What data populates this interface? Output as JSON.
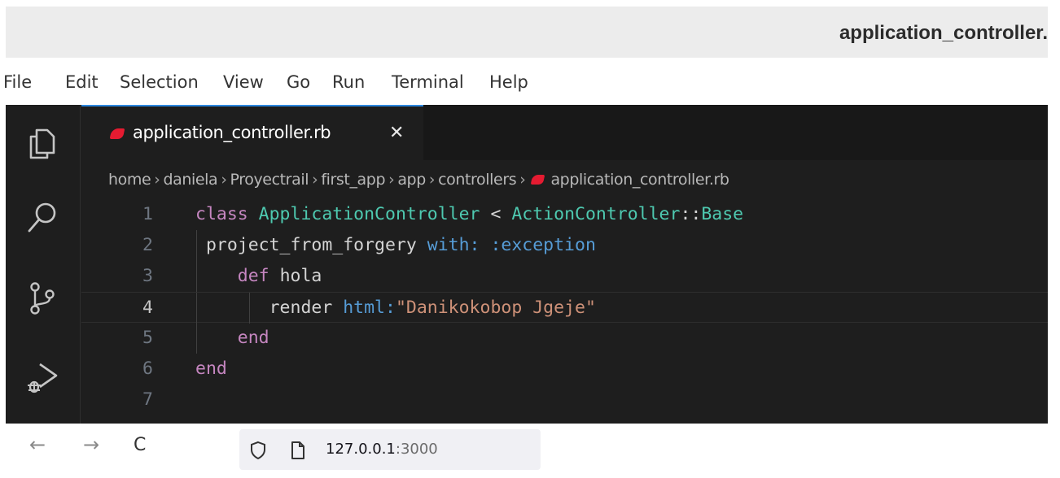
{
  "window": {
    "title": "application_controller."
  },
  "menu": [
    "File",
    "Edit",
    "Selection",
    "View",
    "Go",
    "Run",
    "Terminal",
    "Help"
  ],
  "activity_bar": [
    "explorer-icon",
    "search-icon",
    "source-control-icon",
    "run-debug-icon"
  ],
  "tab": {
    "label": "application_controller.rb",
    "close": "✕",
    "icon": "ruby-icon",
    "modified_color": "#e51b31"
  },
  "breadcrumb": [
    "home",
    "daniela",
    "Proyectrail",
    "first_app",
    "app",
    "controllers",
    "application_controller.rb"
  ],
  "breadcrumb_separator": "›",
  "code": {
    "line_numbers": [
      "1",
      "2",
      "3",
      "4",
      "5",
      "6",
      "7"
    ],
    "current_line": "4",
    "lines": [
      [
        {
          "t": "class ",
          "c": "kw"
        },
        {
          "t": "ApplicationController",
          "c": "cls"
        },
        {
          "t": " < ",
          "c": "plain"
        },
        {
          "t": "ActionController",
          "c": "cls"
        },
        {
          "t": "::",
          "c": "plain"
        },
        {
          "t": "Base",
          "c": "cls"
        }
      ],
      [
        {
          "t": " project_from_forgery ",
          "c": "plain"
        },
        {
          "t": "with: :exception",
          "c": "sym"
        }
      ],
      [
        {
          "t": "    ",
          "c": "plain"
        },
        {
          "t": "def ",
          "c": "kw"
        },
        {
          "t": "hola",
          "c": "plain"
        }
      ],
      [
        {
          "t": "       render ",
          "c": "plain"
        },
        {
          "t": "html:",
          "c": "sym"
        },
        {
          "t": "\"Danikokobop Jgeje\"",
          "c": "str"
        }
      ],
      [
        {
          "t": "    ",
          "c": "plain"
        },
        {
          "t": "end",
          "c": "kw"
        }
      ],
      [
        {
          "t": "end",
          "c": "kw"
        }
      ],
      []
    ]
  },
  "browser": {
    "back": "←",
    "forward": "→",
    "reload": "C",
    "host": "127.0.0.1",
    "port": ":3000"
  }
}
